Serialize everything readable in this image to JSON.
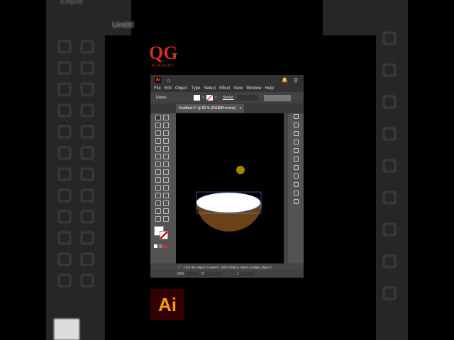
{
  "background": {
    "blur_left_title": "Ellipse",
    "blur_tab": "Untitl"
  },
  "logo": {
    "letters": "QG",
    "subtitle": "ACADEMY"
  },
  "app": {
    "logo": "Ai",
    "menu": [
      "File",
      "Edit",
      "Object",
      "Type",
      "Select",
      "Effect",
      "View",
      "Window",
      "Help"
    ],
    "control": {
      "selection": "Ellipse",
      "stroke_label": "Stroke:"
    },
    "tab": {
      "title": "Untitled-1* @ 50 % (RGB/Preview)",
      "close": "×"
    },
    "status": {
      "hint": "Click the object to select  |  Shift+Click to select multiple object  |",
      "zoom": "50%",
      "angle": "0°",
      "artboard": "1"
    }
  },
  "colors": {
    "accent": "#ff9a00",
    "ai_bg": "#330000",
    "bowl": "#6b4218",
    "cursor": "#c8a800"
  },
  "badge": {
    "label": "Ai"
  }
}
